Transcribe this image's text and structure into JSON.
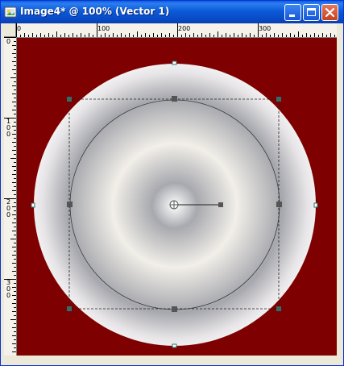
{
  "window": {
    "title": "Image4* @ 100% (Vector 1)",
    "buttons": {
      "minimize": "minimize-icon",
      "maximize": "maximize-icon",
      "close": "close-icon"
    }
  },
  "rulers": {
    "top_labels": [
      "0",
      "100",
      "200",
      "300"
    ],
    "left_labels": [
      "0",
      "100",
      "200",
      "300"
    ]
  },
  "canvas": {
    "background_color": "#7f0000",
    "gradient_colors": [
      "#ffffff",
      "#a8a9af",
      "#f2efe9",
      "#a6a7ad",
      "#e6e4e6"
    ]
  }
}
